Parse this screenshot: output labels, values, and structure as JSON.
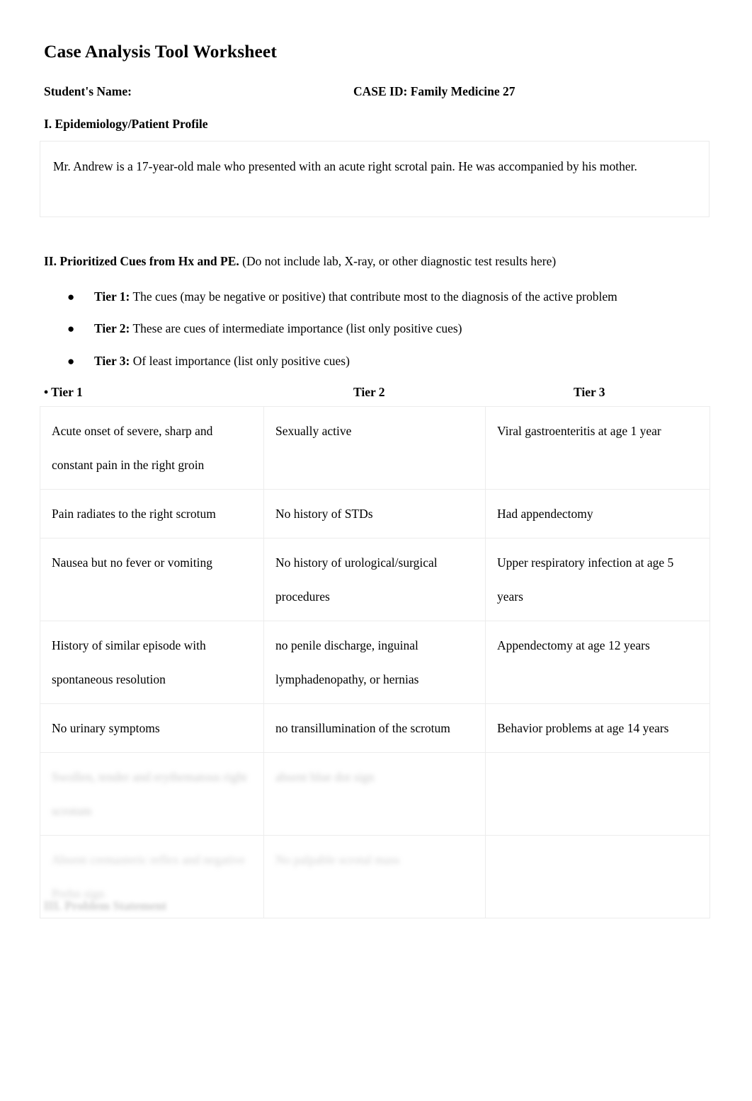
{
  "document": {
    "title": "Case Analysis Tool Worksheet",
    "student_name_label": "Student's Name:",
    "case_id_label": "CASE ID: Family Medicine 27"
  },
  "section1": {
    "heading": "I. Epidemiology/Patient Profile",
    "profile_text": "Mr. Andrew is a 17-year-old male who presented with an acute right scrotal pain. He was accompanied by his mother."
  },
  "section2": {
    "heading_bold": "II. Prioritized Cues from Hx and PE.",
    "heading_note": " (Do not include lab, X-ray, or other diagnostic test results here)",
    "bullets": [
      {
        "marker": "●",
        "label": "Tier 1:",
        "text": " The cues (may be negative or positive) that contribute most to the diagnosis of the active problem"
      },
      {
        "marker": "●",
        "label": "Tier 2:",
        "text": " These are cues of intermediate importance (list only positive cues)"
      },
      {
        "marker": "●",
        "label": "Tier 3:",
        "text": " Of least importance (list only positive cues)"
      }
    ],
    "table_headers": {
      "tier1": "• Tier 1",
      "tier2": "Tier 2",
      "tier3": "Tier 3"
    },
    "table_rows": [
      {
        "tier1": "Acute onset of severe, sharp and constant pain in the right groin",
        "tier2": "Sexually active",
        "tier3": "Viral gastroenteritis at age 1 year",
        "faded": false
      },
      {
        "tier1": "Pain radiates to the right scrotum",
        "tier2": "No history of STDs",
        "tier3": "Had appendectomy",
        "faded": false
      },
      {
        "tier1": "Nausea but no fever or vomiting",
        "tier2": " No history of urological/surgical procedures",
        "tier3": "Upper respiratory infection at age 5 years",
        "faded": false
      },
      {
        "tier1": "History of similar episode with spontaneous resolution",
        "tier2": "no penile discharge, inguinal lymphadenopathy, or hernias",
        "tier3": "Appendectomy at age 12 years",
        "faded": false
      },
      {
        "tier1": "No urinary symptoms",
        "tier2": "no transillumination of the scrotum",
        "tier3": "Behavior problems at age 14 years",
        "faded": false
      },
      {
        "tier1": "Swollen, tender and erythematous right scrotum",
        "tier2": "absent blue dot sign",
        "tier3": "",
        "faded": true
      },
      {
        "tier1": "Absent cremasteric reflex and negative Prehn sign",
        "tier2": "No palpable scrotal mass",
        "tier3": "",
        "faded": true
      }
    ]
  },
  "section3": {
    "heading": "III. Problem Statement"
  }
}
